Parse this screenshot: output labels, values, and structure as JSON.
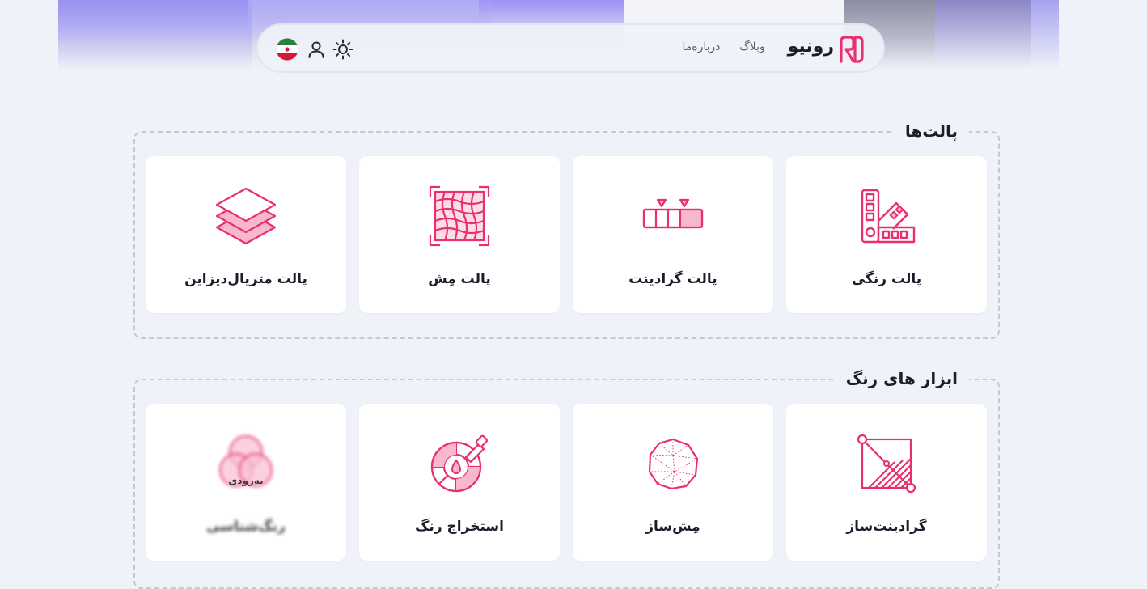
{
  "colors": {
    "accent": "#e8306f",
    "accent_light": "#f7b7cd",
    "background": "#eff2f8",
    "card": "#ffffff",
    "text": "#1c1c2a",
    "muted_text": "#5b5c6c"
  },
  "header": {
    "brand": "رونیو",
    "logo_icon": "ronio-logo-icon",
    "nav": [
      {
        "label": "وبلاگ"
      },
      {
        "label": "درباره‌ما"
      }
    ],
    "icons": [
      "sun-icon",
      "user-icon",
      "iran-flag-icon"
    ]
  },
  "palettes": {
    "title": "پالت‌ها",
    "cards": [
      {
        "label": "پالت رنگی",
        "icon": "color-swatch-icon"
      },
      {
        "label": "پالت گرادینت",
        "icon": "gradient-bar-icon"
      },
      {
        "label": "پالت مِش",
        "icon": "mesh-grid-icon"
      },
      {
        "label": "پالت متریال‌دیزاین",
        "icon": "layers-icon"
      }
    ]
  },
  "tools": {
    "title": "ابزار های رنگ",
    "cards": [
      {
        "label": "گرادینت‌ساز",
        "icon": "gradient-maker-icon"
      },
      {
        "label": "مِش‌ساز",
        "icon": "mesh-sphere-icon"
      },
      {
        "label": "استخراج رنگ",
        "icon": "color-picker-wheel-icon"
      },
      {
        "label": "رنگ‌شناسی",
        "icon": "color-venn-icon",
        "badge": "به‌زودی"
      }
    ]
  }
}
